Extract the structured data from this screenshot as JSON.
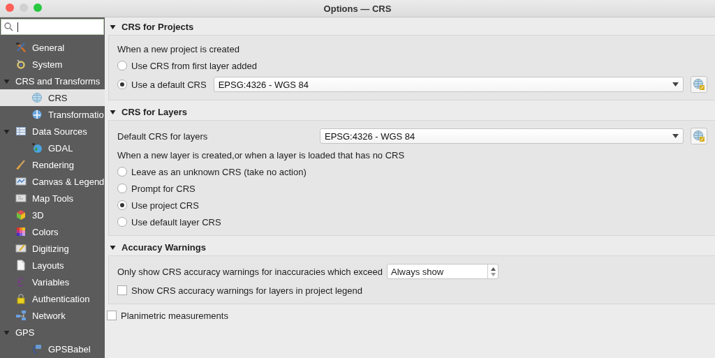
{
  "window": {
    "title": "Options — CRS"
  },
  "sidebar": {
    "items": [
      {
        "label": "General",
        "selected": false
      },
      {
        "label": "System",
        "selected": false
      },
      {
        "label": "CRS and Transforms",
        "selected": false,
        "expanded": true,
        "children": [
          {
            "label": "CRS",
            "selected": true
          },
          {
            "label": "Transformatio",
            "selected": false
          }
        ]
      },
      {
        "label": "Data Sources",
        "selected": false,
        "expanded": true,
        "children": [
          {
            "label": "GDAL",
            "selected": false
          }
        ]
      },
      {
        "label": "Rendering",
        "selected": false
      },
      {
        "label": "Canvas & Legend",
        "selected": false
      },
      {
        "label": "Map Tools",
        "selected": false
      },
      {
        "label": "3D",
        "selected": false
      },
      {
        "label": "Colors",
        "selected": false
      },
      {
        "label": "Digitizing",
        "selected": false
      },
      {
        "label": "Layouts",
        "selected": false
      },
      {
        "label": "Variables",
        "selected": false
      },
      {
        "label": "Authentication",
        "selected": false
      },
      {
        "label": "Network",
        "selected": false
      },
      {
        "label": "GPS",
        "selected": false,
        "expanded": true,
        "children": [
          {
            "label": "GPSBabel",
            "selected": false
          }
        ]
      }
    ]
  },
  "sections": [
    {
      "title": "CRS for Projects",
      "expanded": true,
      "rows": [
        {
          "kind": "label",
          "text": "When a new project is created"
        },
        {
          "kind": "radio",
          "label": "Use CRS from first layer added",
          "selected": false
        },
        {
          "kind": "radio-combo",
          "label": "Use a default CRS",
          "selected": true,
          "value": "EPSG:4326 - WGS 84"
        }
      ]
    },
    {
      "title": "CRS for Layers",
      "expanded": true,
      "rows": [
        {
          "kind": "combo",
          "label": "Default CRS for layers",
          "value": "EPSG:4326 - WGS 84"
        },
        {
          "kind": "label",
          "text": "When a new layer is created,or when a layer is loaded that has no CRS"
        },
        {
          "kind": "radio",
          "label": "Leave as an unknown CRS (take no action)",
          "selected": false
        },
        {
          "kind": "radio",
          "label": "Prompt for CRS",
          "selected": false
        },
        {
          "kind": "radio",
          "label": "Use project CRS",
          "selected": true
        },
        {
          "kind": "radio",
          "label": "Use default layer CRS",
          "selected": false
        }
      ]
    },
    {
      "title": "Accuracy Warnings",
      "expanded": true,
      "rows": [
        {
          "kind": "spin",
          "label": "Only show CRS accuracy warnings for inaccuracies which exceed",
          "value": "Always show"
        },
        {
          "kind": "checkbox",
          "label": "Show CRS accuracy warnings for layers in project legend",
          "checked": false
        }
      ]
    }
  ],
  "planimetric": {
    "label": "Planimetric measurements",
    "checked": false
  }
}
